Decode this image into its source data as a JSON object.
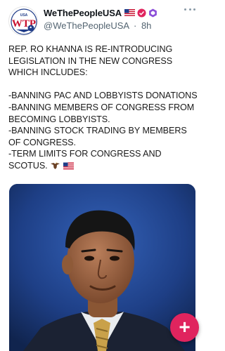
{
  "post": {
    "author": {
      "display_name": "WeThePeopleUSA",
      "handle": "@WeThePeopleUSA",
      "timestamp": "8h",
      "separator": "·",
      "avatar_text": "WTP",
      "avatar_small_text": "USA",
      "badges": [
        "us-flag-emoji",
        "verified-red-badge",
        "purple-hex-badge"
      ]
    },
    "text": {
      "intro": "REP. RO KHANNA IS RE-INTRODUCING LEGISLATION IN THE NEW CONGRESS WHICH INCLUDES:",
      "items": [
        "-BANNING PAC AND LOBBYISTS DONATIONS -BANNING MEMBERS OF CONGRESS FROM BECOMING LOBBYISTS.",
        "-BANNING STOCK TRADING BY MEMBERS OF CONGRESS.",
        "-TERM LIMITS FOR CONGRESS AND SCOTUS."
      ],
      "trailing_emojis": [
        "eagle-emoji",
        "us-flag-emoji"
      ]
    },
    "media": {
      "type": "photo",
      "subject": "portrait-photo"
    },
    "compose": {
      "label": "+"
    }
  },
  "colors": {
    "accent_red": "#e0245e",
    "muted_text": "#536471",
    "media_background": "#1d3a78"
  }
}
